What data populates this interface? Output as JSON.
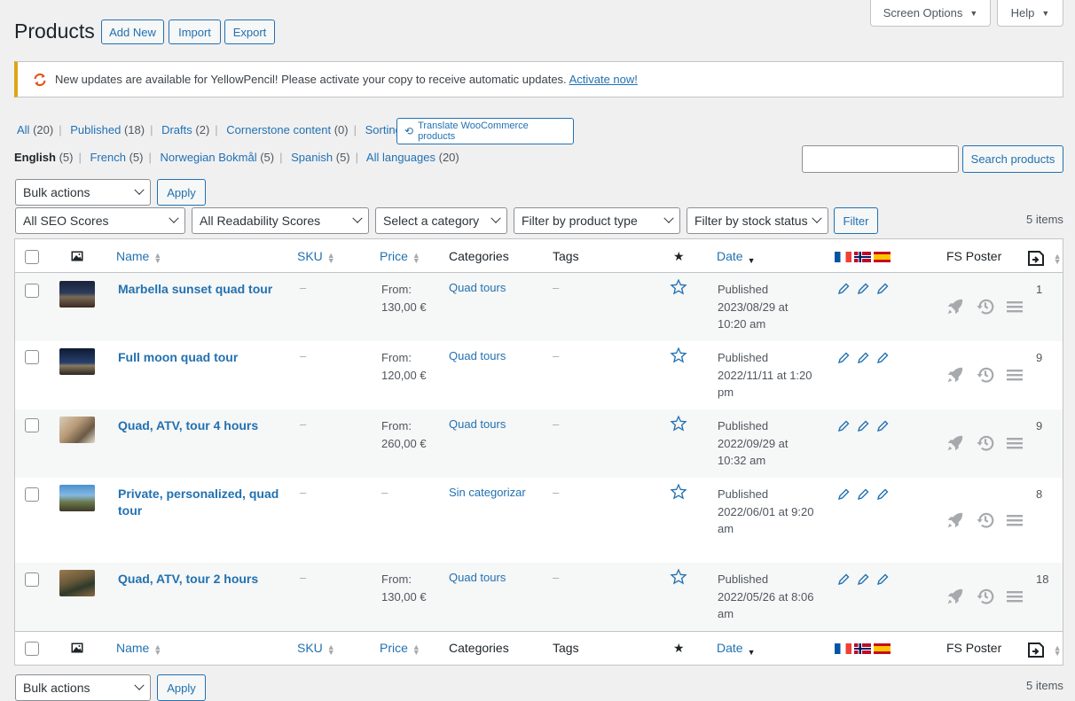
{
  "header": {
    "title": "Products",
    "buttons": [
      "Add New",
      "Import",
      "Export"
    ],
    "screen_options": "Screen Options",
    "help": "Help"
  },
  "notice": {
    "text": "New updates are available for YellowPencil! Please activate your copy to receive automatic updates.",
    "link": "Activate now!"
  },
  "status_filters": [
    {
      "label": "All",
      "count": "(20)"
    },
    {
      "label": "Published",
      "count": "(18)"
    },
    {
      "label": "Drafts",
      "count": "(2)"
    },
    {
      "label": "Cornerstone content",
      "count": "(0)"
    },
    {
      "label": "Sorting",
      "count": ""
    }
  ],
  "translate_button": "Translate WooCommerce products",
  "language_filters": [
    {
      "label": "English",
      "count": "(5)"
    },
    {
      "label": "French",
      "count": "(5)"
    },
    {
      "label": "Norwegian Bokmål",
      "count": "(5)"
    },
    {
      "label": "Spanish",
      "count": "(5)"
    },
    {
      "label": "All languages",
      "count": "(20)"
    }
  ],
  "search_button": "Search products",
  "bulk": {
    "select": "Bulk actions",
    "apply": "Apply"
  },
  "filters": {
    "seo": "All SEO Scores",
    "readability": "All Readability Scores",
    "category": "Select a category",
    "product_type": "Filter by product type",
    "stock": "Filter by stock status",
    "button": "Filter"
  },
  "items_count": "5 items",
  "columns": {
    "name": "Name",
    "sku": "SKU",
    "price": "Price",
    "categories": "Categories",
    "tags": "Tags",
    "date": "Date",
    "fs_poster": "FS Poster"
  },
  "colors": {
    "link": "#2271b1",
    "notice_border": "#dba617",
    "refresh": "#e3541c"
  },
  "products": [
    {
      "name": "Marbella sunset quad tour",
      "sku": "–",
      "price_label": "From:",
      "price": "130,00 €",
      "category": "Quad tours",
      "tags": "–",
      "status": "Published",
      "date_lines": [
        "2023/08/29 at",
        "10:20 am"
      ],
      "count": "1",
      "thumb": "night"
    },
    {
      "name": "Full moon quad tour",
      "sku": "–",
      "price_label": "From:",
      "price": "120,00 €",
      "category": "Quad tours",
      "tags": "–",
      "status": "Published",
      "date_lines": [
        "2022/11/11 at 1:20",
        "pm"
      ],
      "count": "9",
      "thumb": "night"
    },
    {
      "name": "Quad, ATV, tour 4 hours",
      "sku": "–",
      "price_label": "From:",
      "price": "260,00 €",
      "category": "Quad tours",
      "tags": "–",
      "status": "Published",
      "date_lines": [
        "2022/09/29 at",
        "10:32 am"
      ],
      "count": "9",
      "thumb": "dust"
    },
    {
      "name_lines": [
        "Private, personalized, quad",
        "tour"
      ],
      "sku": "–",
      "price_label": "",
      "price": "–",
      "category": "Sin categorizar",
      "tags": "–",
      "status": "Published",
      "date_lines": [
        "2022/06/01 at 9:20",
        "am"
      ],
      "count": "8",
      "thumb": "sky"
    },
    {
      "name": "Quad, ATV, tour 2 hours",
      "sku": "–",
      "price_label": "From:",
      "price": "130,00 €",
      "category": "Quad tours",
      "tags": "–",
      "status": "Published",
      "date_lines": [
        "2022/05/26 at 8:06",
        "am"
      ],
      "count": "18",
      "thumb": "earth"
    }
  ]
}
